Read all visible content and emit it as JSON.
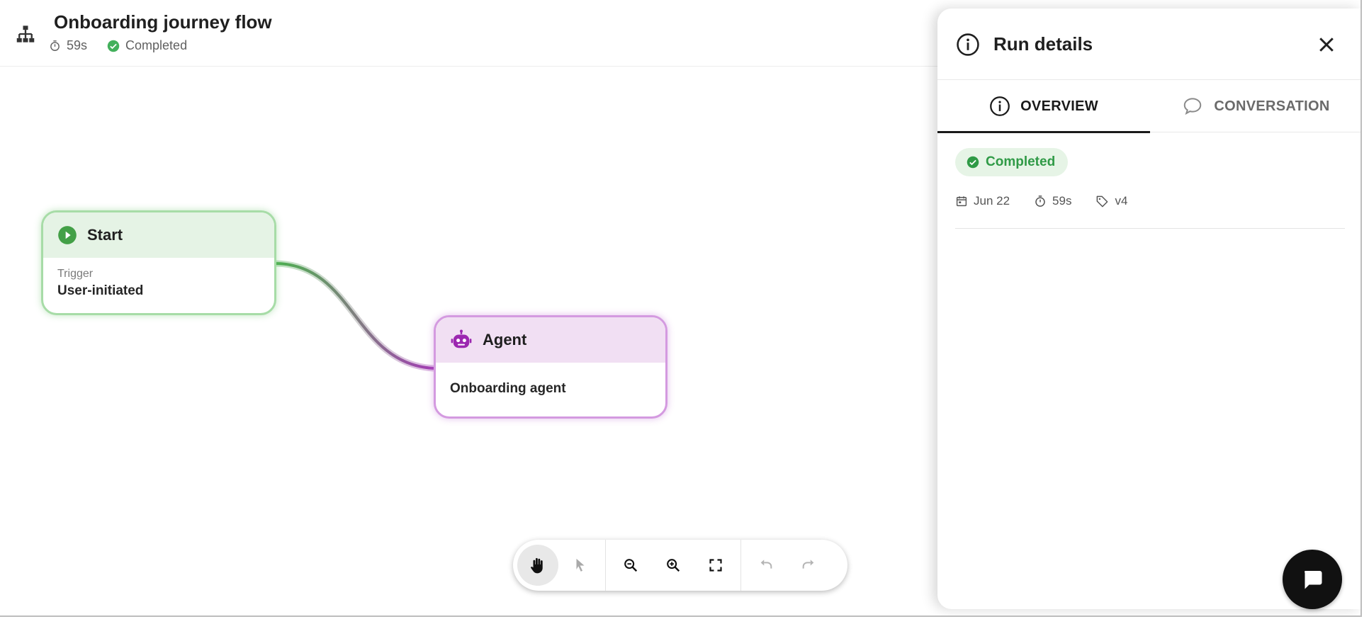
{
  "header": {
    "title": "Onboarding journey flow",
    "duration": "59s",
    "status": "Completed",
    "icon": "sitemap-icon"
  },
  "canvas": {
    "nodes": [
      {
        "id": "start",
        "title": "Start",
        "icon": "play-circle-icon",
        "field_label": "Trigger",
        "field_value": "User-initiated",
        "color": "#43a047"
      },
      {
        "id": "agent",
        "title": "Agent",
        "icon": "robot-icon",
        "field_value": "Onboarding agent",
        "color": "#9c27b0"
      }
    ],
    "edge": {
      "from": "start",
      "to": "agent",
      "from_color": "#4caf50",
      "to_color": "#a33bb5"
    }
  },
  "toolbar": {
    "tools": [
      {
        "name": "pan-tool",
        "icon": "hand-icon",
        "active": true
      },
      {
        "name": "select-tool",
        "icon": "pointer-icon",
        "enabled": false
      },
      {
        "name": "zoom-out",
        "icon": "zoom-out-icon"
      },
      {
        "name": "zoom-in",
        "icon": "zoom-in-icon"
      },
      {
        "name": "fit-view",
        "icon": "fullscreen-icon"
      },
      {
        "name": "undo",
        "icon": "undo-icon",
        "enabled": false
      },
      {
        "name": "redo",
        "icon": "redo-icon",
        "enabled": false
      }
    ]
  },
  "panel": {
    "title": "Run details",
    "tabs": [
      {
        "label": "OVERVIEW",
        "icon": "info-icon",
        "selected": true
      },
      {
        "label": "CONVERSATION",
        "icon": "chat-bubble-icon",
        "selected": false
      }
    ],
    "status": "Completed",
    "status_color": "#2f9a46",
    "date": "Jun 22",
    "duration": "59s",
    "version": "v4"
  },
  "colors": {
    "accent_dark": "#1a1a1a",
    "success": "#43a047",
    "agent": "#9c27b0"
  }
}
